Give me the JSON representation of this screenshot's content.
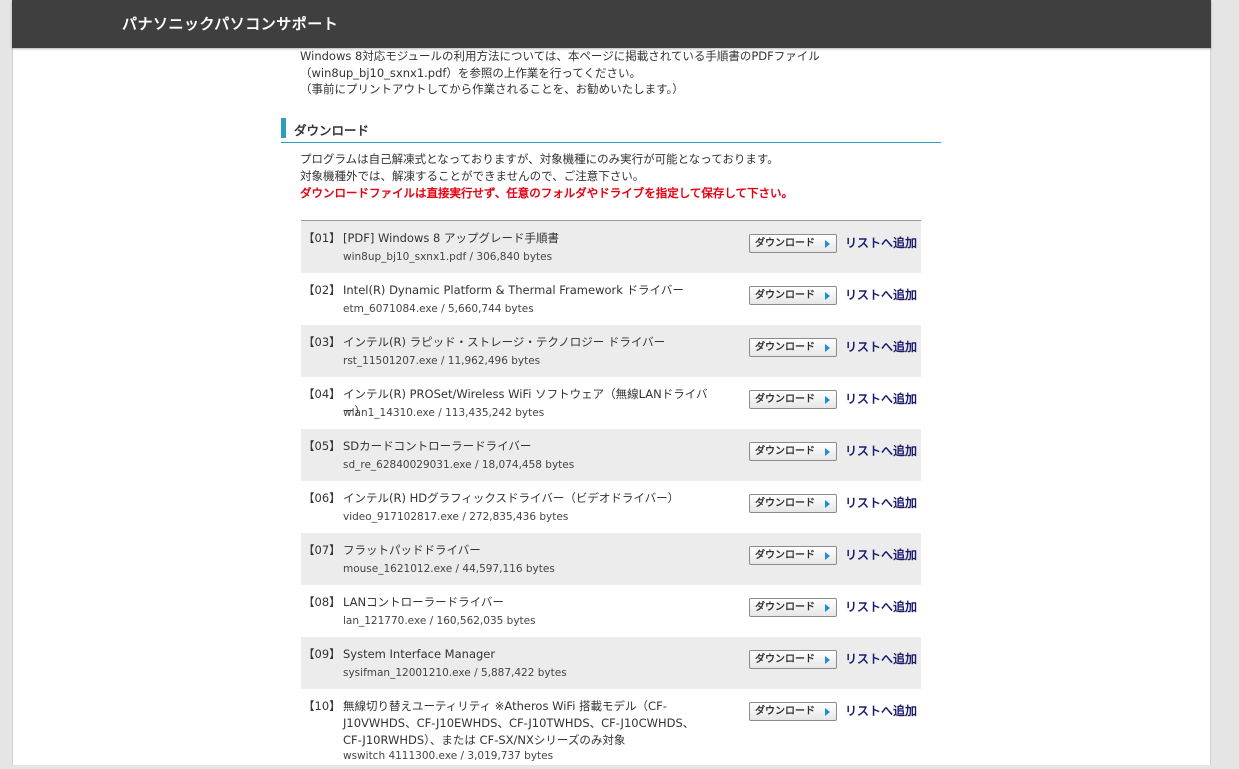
{
  "header": {
    "title": "パナソニックパソコンサポート"
  },
  "intro": {
    "lines": [
      "Windows 8対応モジュールの利用方法については、本ページに掲載されている手順書のPDFファイル",
      "（win8up_bj10_sxnx1.pdf）を参照の上作業を行ってください。",
      "（事前にプリントアウトしてから作業されることを、お勧めいたします。）"
    ]
  },
  "section": {
    "title": "ダウンロード"
  },
  "notes": {
    "line1": "プログラムは自己解凍式となっておりますが、対象機種にのみ実行が可能となっております。",
    "line2": "対象機種外では、解凍することができませんので、ご注意下さい。",
    "warning": "ダウンロードファイルは直接実行せず、任意のフォルダやドライブを指定して保存して下さい。"
  },
  "download_label": "ダウンロード",
  "add_label": "リストへ追加",
  "items": [
    {
      "num": "【01】",
      "name": "[PDF] Windows 8 アップグレード手順書",
      "file": "win8up_bj10_sxnx1.pdf / 306,840 bytes"
    },
    {
      "num": "【02】",
      "name": "Intel(R) Dynamic Platform & Thermal Framework ドライバー",
      "file": "etm_6071084.exe / 5,660,744 bytes"
    },
    {
      "num": "【03】",
      "name": "インテル(R) ラピッド・ストレージ・テクノロジー ドライバー",
      "file": "rst_11501207.exe / 11,962,496 bytes"
    },
    {
      "num": "【04】",
      "name": "インテル(R) PROSet/Wireless WiFi ソフトウェア（無線LANドライバー）",
      "file": "wlan1_14310.exe / 113,435,242 bytes"
    },
    {
      "num": "【05】",
      "name": "SDカードコントローラードライバー",
      "file": "sd_re_62840029031.exe / 18,074,458 bytes"
    },
    {
      "num": "【06】",
      "name": "インテル(R) HDグラフィックスドライバー（ビデオドライバー）",
      "file": "video_917102817.exe / 272,835,436 bytes"
    },
    {
      "num": "【07】",
      "name": "フラットパッドドライバー",
      "file": "mouse_1621012.exe / 44,597,116 bytes"
    },
    {
      "num": "【08】",
      "name": "LANコントローラードライバー",
      "file": "lan_121770.exe / 160,562,035 bytes"
    },
    {
      "num": "【09】",
      "name": "System Interface Manager",
      "file": "sysifman_12001210.exe / 5,887,422 bytes"
    },
    {
      "num": "【10】",
      "name": "無線切り替えユーティリティ ※Atheros WiFi 搭載モデル（CF-J10VWHDS、CF-J10EWHDS、CF-J10TWHDS、CF-J10CWHDS、CF-J10RWHDS）、または CF-SX/NXシリーズのみ対象",
      "file": "wswitch 4111300.exe / 3,019,737 bytes"
    }
  ]
}
